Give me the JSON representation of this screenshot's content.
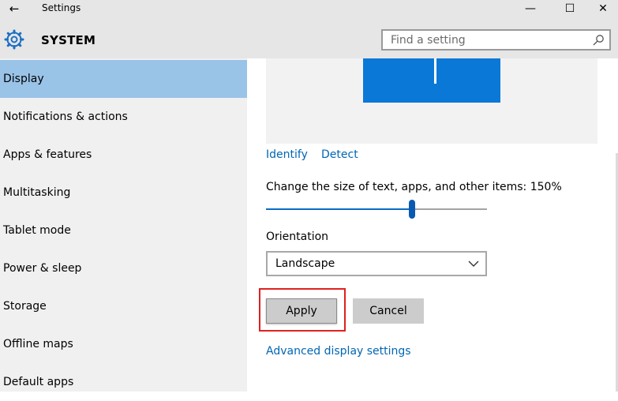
{
  "window": {
    "title": "Settings",
    "back_icon": "←",
    "minimize_icon": "—",
    "maximize_icon": "☐",
    "close_icon": "✕"
  },
  "header": {
    "icon": "gear-icon",
    "title": "SYSTEM",
    "search_placeholder": "Find a setting"
  },
  "sidebar": {
    "items": [
      {
        "label": "Display",
        "active": true
      },
      {
        "label": "Notifications & actions",
        "active": false
      },
      {
        "label": "Apps & features",
        "active": false
      },
      {
        "label": "Multitasking",
        "active": false
      },
      {
        "label": "Tablet mode",
        "active": false
      },
      {
        "label": "Power & sleep",
        "active": false
      },
      {
        "label": "Storage",
        "active": false
      },
      {
        "label": "Offline maps",
        "active": false
      },
      {
        "label": "Default apps",
        "active": false
      }
    ]
  },
  "display": {
    "identify_label": "Identify",
    "detect_label": "Detect",
    "scale_label": "Change the size of text, apps, and other items: 150%",
    "scale_slider_fraction": 0.66,
    "orientation_label": "Orientation",
    "orientation_value": "Landscape",
    "apply_label": "Apply",
    "cancel_label": "Cancel",
    "advanced_link": "Advanced display settings"
  },
  "colors": {
    "accent": "#0a78d7",
    "sidebar_active": "#9ac3e8",
    "highlight_border": "#e02020",
    "link": "#0066b4"
  }
}
